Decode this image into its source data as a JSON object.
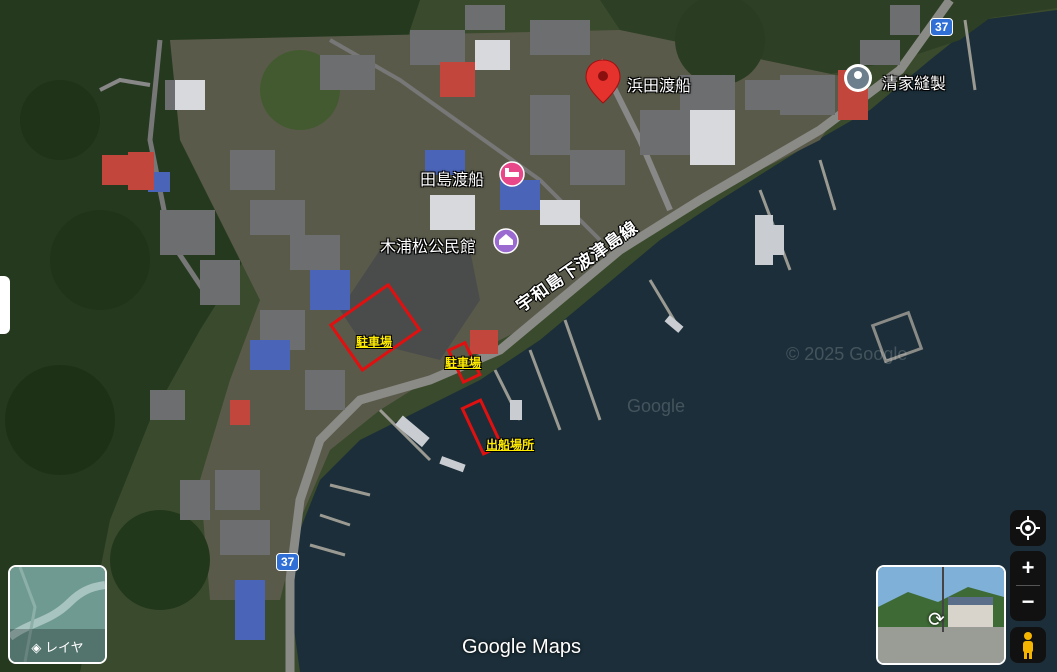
{
  "map": {
    "places": {
      "hamada_ferry": "浜田渡船",
      "seike_sewing": "清家縫製",
      "tajima_ferry": "田島渡船",
      "kiuramatsu_hall": "木浦松公民館"
    },
    "road_name": "宇和島下波津島線",
    "route_shield_top": "37",
    "route_shield_bottom": "37",
    "annotations": {
      "parking_large": "駐車場",
      "parking_small": "駐車場",
      "boarding_place": "出船場所"
    },
    "watermarks": [
      "© 2025 Google",
      "Google"
    ],
    "attribution": "Google Maps"
  },
  "controls": {
    "layers_label": "レイヤ",
    "zoom_in": "+",
    "zoom_out": "−"
  },
  "colors": {
    "pin_red": "#e5322d",
    "annotation_red": "#e01010",
    "annotation_text": "#ffeb00",
    "hotel_pink": "#e8488a",
    "civic_purple": "#9b6ad0",
    "route_blue": "#2f6fd6",
    "water": "#1a2d38"
  },
  "icons": [
    "map-pin-icon",
    "place-marker-icon",
    "hotel-icon",
    "civic-building-icon",
    "my-location-icon",
    "layers-icon",
    "pegman-icon",
    "rotate-360-icon"
  ]
}
